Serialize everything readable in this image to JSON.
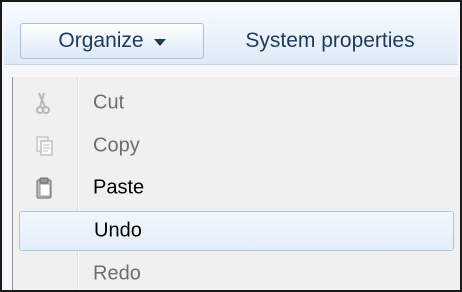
{
  "toolbar": {
    "organize_label": "Organize",
    "system_properties_label": "System properties"
  },
  "menu": {
    "items": [
      {
        "label": "Cut",
        "icon": "scissors-icon",
        "enabled": false
      },
      {
        "label": "Copy",
        "icon": "copy-icon",
        "enabled": false
      },
      {
        "label": "Paste",
        "icon": "paste-clipboard-icon",
        "enabled": true
      },
      {
        "label": "Undo",
        "icon": "",
        "enabled": true,
        "highlighted": true
      },
      {
        "label": "Redo",
        "icon": "",
        "enabled": false
      }
    ]
  },
  "colors": {
    "toolbar_text": "#1e395b",
    "hover_border": "#a8c7ea",
    "disabled_text": "#6d6d6d"
  }
}
